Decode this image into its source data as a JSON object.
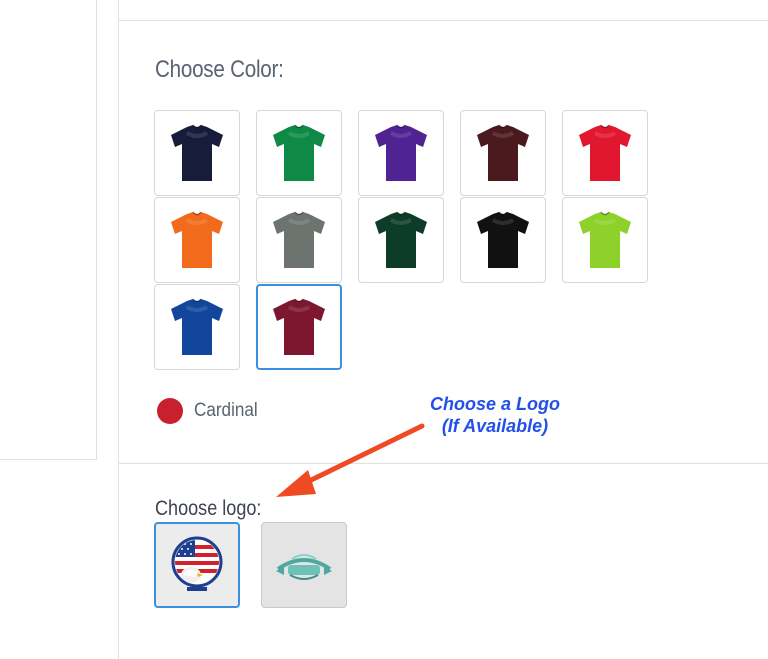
{
  "color_section": {
    "title": "Choose Color:",
    "swatches": [
      {
        "name": "navy-tshirt",
        "color": "#161c3a"
      },
      {
        "name": "green-tshirt",
        "color": "#0e8a46"
      },
      {
        "name": "purple-tshirt",
        "color": "#4f2391"
      },
      {
        "name": "maroon-tshirt",
        "color": "#4b1a1f"
      },
      {
        "name": "red-tshirt",
        "color": "#e0172f"
      },
      {
        "name": "orange-tshirt",
        "color": "#f26a1b"
      },
      {
        "name": "gray-tshirt",
        "color": "#6d736e"
      },
      {
        "name": "forest-green-tshirt",
        "color": "#0d3d29"
      },
      {
        "name": "black-tshirt",
        "color": "#111111"
      },
      {
        "name": "lime-tshirt",
        "color": "#8ed12a"
      },
      {
        "name": "royal-blue-tshirt",
        "color": "#11469c"
      },
      {
        "name": "cardinal-tshirt",
        "color": "#7d1730",
        "selected": true
      }
    ],
    "selected": {
      "label": "Cardinal",
      "dot_color": "#c8202f"
    }
  },
  "annotation": {
    "line1": "Choose a Logo",
    "line2": "(If Available)",
    "color": "#2250e8",
    "arrow_color": "#f04a24"
  },
  "logo_section": {
    "title": "Choose logo:",
    "options": [
      {
        "name": "flag-eagle-logo",
        "selected": true
      },
      {
        "name": "teal-boat-logo",
        "selected": false
      }
    ]
  },
  "accent_color": "#3b8fe0"
}
